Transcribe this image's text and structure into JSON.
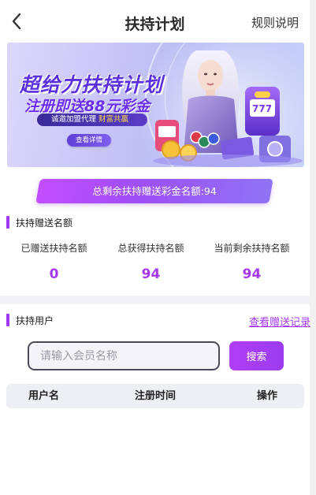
{
  "header": {
    "title": "扶持计划",
    "rules_label": "规则说明"
  },
  "banner": {
    "headline": "超给力扶持计划",
    "subhead": "注册即送88元彩金",
    "strip_text": "诚邀加盟代理",
    "strip_highlight": "财富共赢",
    "button_label": "查看详情"
  },
  "remaining": {
    "text": "总剩余扶持赠送彩金名额:94"
  },
  "quota_section": {
    "title": "扶持赠送名额",
    "stats": [
      {
        "label": "已赠送扶持名额",
        "value": "0"
      },
      {
        "label": "总获得扶持名额",
        "value": "94"
      },
      {
        "label": "当前剩余扶持名额",
        "value": "94"
      }
    ]
  },
  "users_section": {
    "title": "扶持用户",
    "records_link": "查看赠送记录",
    "search": {
      "placeholder": "请输入会员名称",
      "value": "",
      "button_label": "搜索"
    },
    "table": {
      "columns": [
        "用户名",
        "注册时间",
        "操作"
      ]
    }
  },
  "colors": {
    "accent": "#a437f0",
    "pill_start": "#c14dff",
    "pill_end": "#8f74f5"
  },
  "icons": {
    "back": "chevron-left-icon"
  }
}
